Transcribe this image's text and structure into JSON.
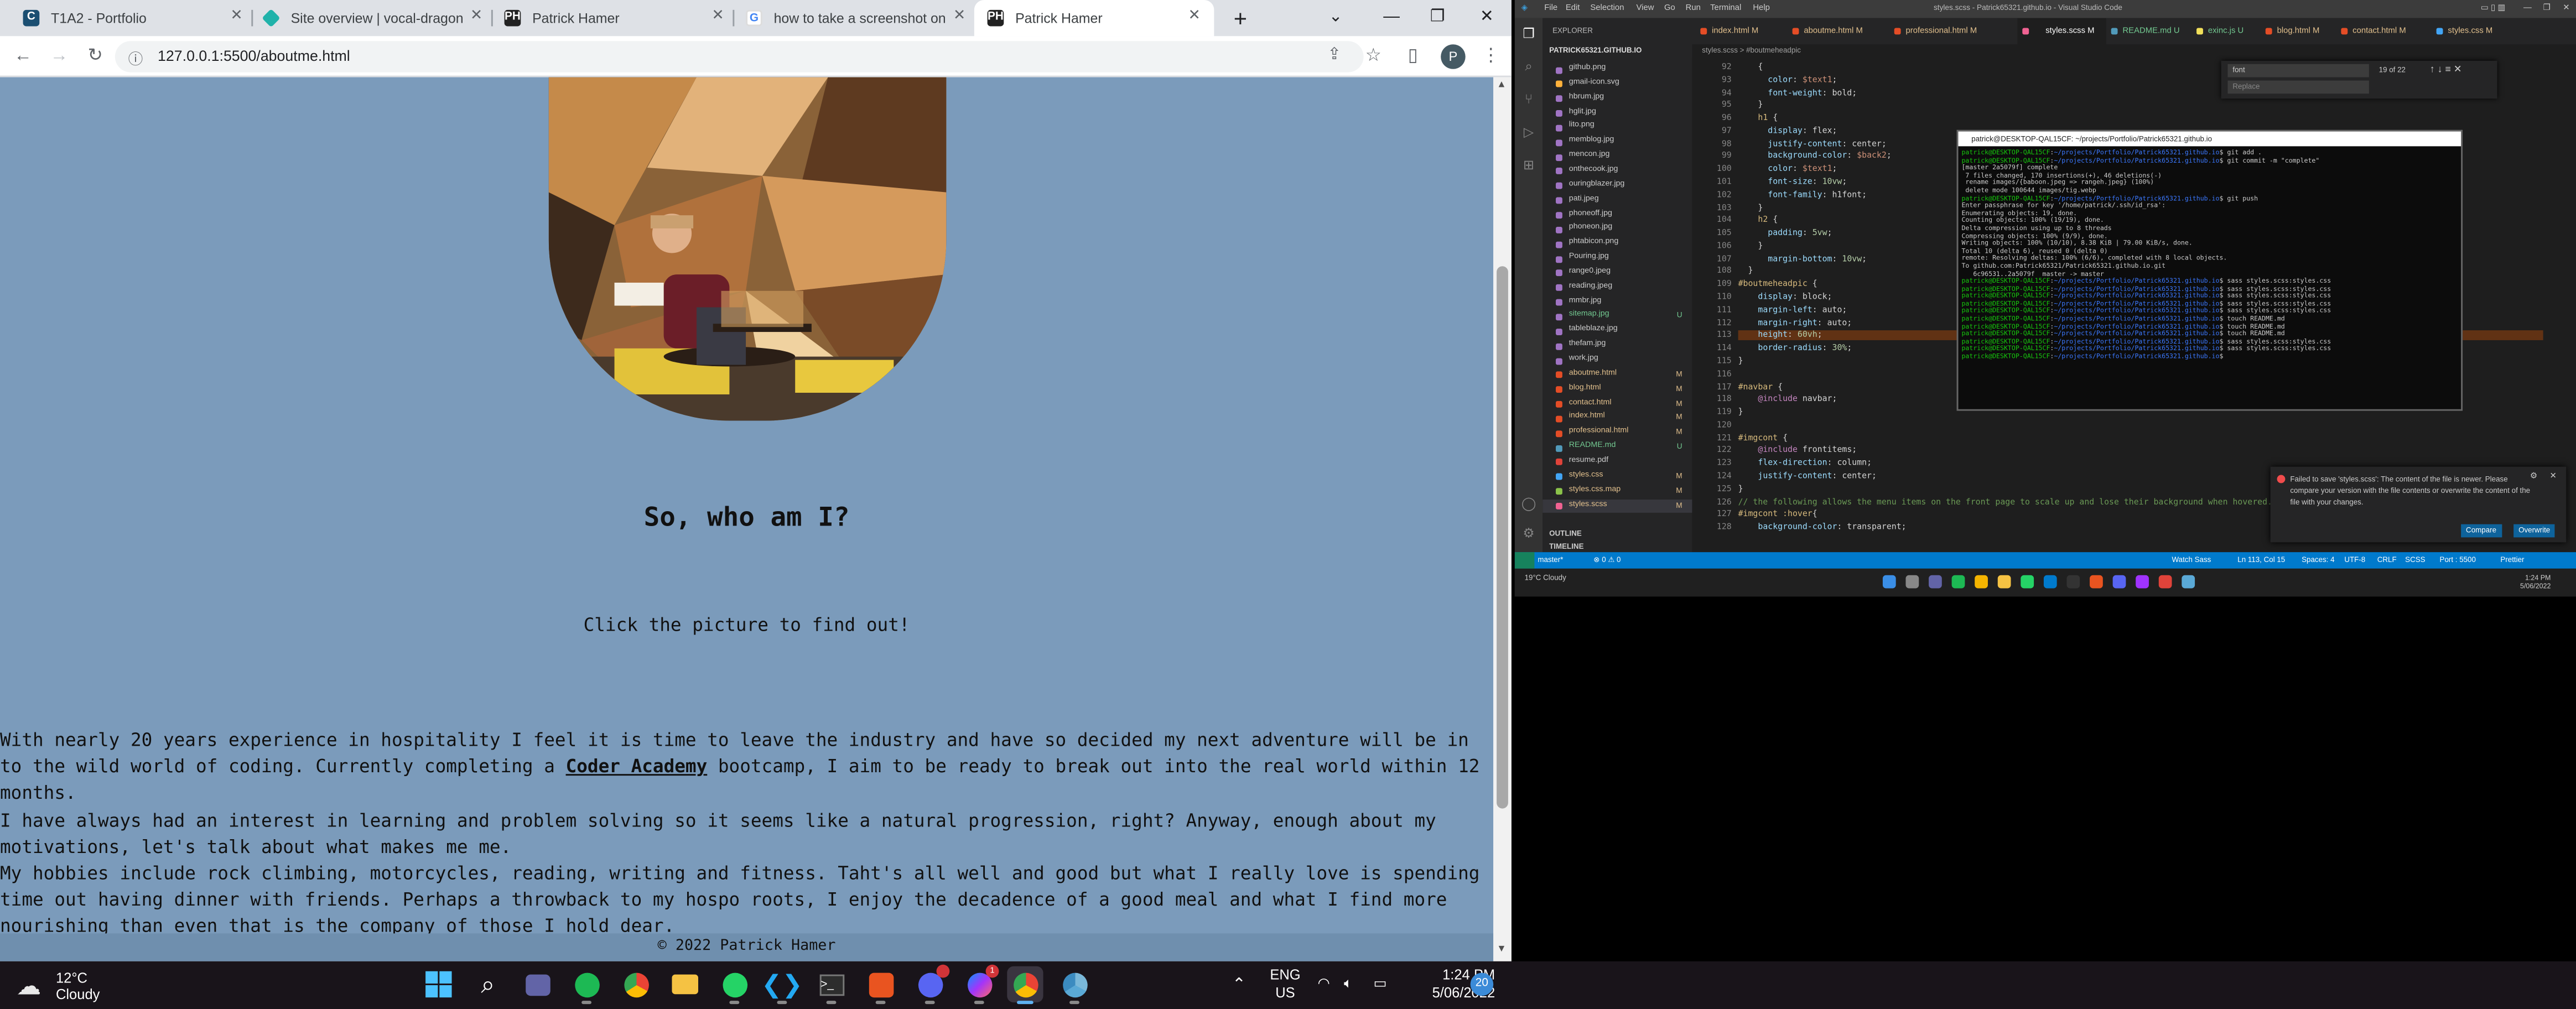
{
  "browser": {
    "tabs": [
      {
        "title": "T1A2 - Portfolio",
        "icon": "canvas-icon",
        "color": "#1b4f72",
        "active": false
      },
      {
        "title": "Site overview | vocal-dragon",
        "icon": "netlify-icon",
        "color": "#20b2aa",
        "active": false
      },
      {
        "title": "Patrick Hamer",
        "icon": "ph-icon",
        "color": "#222222",
        "active": false
      },
      {
        "title": "how to take a screenshot on",
        "icon": "google-icon",
        "color": "#4285f4",
        "active": false
      },
      {
        "title": "Patrick Hamer",
        "icon": "ph-icon",
        "color": "#222222",
        "active": true
      }
    ],
    "new_tab": "+",
    "url": "127.0.0.1:5500/aboutme.html",
    "profile_initial": "P"
  },
  "page": {
    "heading": "So, who am I?",
    "subheading": "Click the picture to find out!",
    "bio_p1_before": "With nearly 20 years experience in hospitality I feel it is time to leave the industry and have so decided my next adventure will be in to the wild world of coding. Currently completing a ",
    "bio_link": "Coder Academy",
    "bio_p1_after": " bootcamp, I aim to be ready to break out into the real world within 12 months.",
    "bio_p2": "I have always had an interest in learning and problem solving so it seems like a natural progression, right? Anyway, enough about my motivations, let's talk about what makes me me.",
    "bio_p3": "My hobbies include rock climbing, motorcycles, reading, writing and fitness. Taht's all well and good but what I really love is spending time out having dinner with friends. Perhaps a throwback to my hospo roots, I enjoy the decadence of a good meal and what I find more nourishing than even that is the company of those I hold dear.",
    "footer": "© 2022 Patrick Hamer",
    "background_color": "#7b9bbb"
  },
  "vscode": {
    "title": "styles.scss - Patrick65321.github.io - Visual Studio Code",
    "menu": [
      "File",
      "Edit",
      "Selection",
      "View",
      "Go",
      "Run",
      "Terminal",
      "Help"
    ],
    "explorer_label": "EXPLORER",
    "project": "PATRICK65321.GITHUB.IO",
    "files": [
      {
        "name": "github.png",
        "badge": ""
      },
      {
        "name": "gmail-icon.svg",
        "badge": ""
      },
      {
        "name": "hbrum.jpg",
        "badge": ""
      },
      {
        "name": "hglit.jpg",
        "badge": ""
      },
      {
        "name": "lito.png",
        "badge": ""
      },
      {
        "name": "memblog.jpg",
        "badge": ""
      },
      {
        "name": "mencon.jpg",
        "badge": ""
      },
      {
        "name": "onthecook.jpg",
        "badge": ""
      },
      {
        "name": "ouringblazer.jpg",
        "badge": ""
      },
      {
        "name": "pati.jpeg",
        "badge": ""
      },
      {
        "name": "phoneoff.jpg",
        "badge": ""
      },
      {
        "name": "phoneon.jpg",
        "badge": ""
      },
      {
        "name": "phtabicon.png",
        "badge": ""
      },
      {
        "name": "Pouring.jpg",
        "badge": ""
      },
      {
        "name": "range0.jpeg",
        "badge": ""
      },
      {
        "name": "reading.jpeg",
        "badge": ""
      },
      {
        "name": "mmbr.jpg",
        "badge": ""
      },
      {
        "name": "sitemap.jpg",
        "badge": "U"
      },
      {
        "name": "tableblaze.jpg",
        "badge": ""
      },
      {
        "name": "thefam.jpg",
        "badge": ""
      },
      {
        "name": "work.jpg",
        "badge": ""
      },
      {
        "name": "aboutme.html",
        "badge": "M"
      },
      {
        "name": "blog.html",
        "badge": "M"
      },
      {
        "name": "contact.html",
        "badge": "M"
      },
      {
        "name": "index.html",
        "badge": "M"
      },
      {
        "name": "professional.html",
        "badge": "M"
      },
      {
        "name": "README.md",
        "badge": "U"
      },
      {
        "name": "resume.pdf",
        "badge": ""
      },
      {
        "name": "styles.css",
        "badge": "M"
      },
      {
        "name": "styles.css.map",
        "badge": "M"
      },
      {
        "name": "styles.scss",
        "badge": "M"
      }
    ],
    "outline_label": "OUTLINE",
    "timeline_label": "TIMELINE",
    "tabs": [
      "index.html M",
      "aboutme.html M",
      "professional.html M",
      "styles.scss M",
      "README.md U",
      "exinc.js U",
      "blog.html M",
      "contact.html M",
      "styles.css M"
    ],
    "breadcrumb": "styles.scss > #boutmeheadpic",
    "find_value": "font",
    "find_count": "19 of 22",
    "replace_placeholder": "Replace",
    "line_numbers": [
      "92",
      "93",
      "94",
      "95",
      "96",
      "97",
      "98",
      "99",
      "100",
      "101",
      "102",
      "103",
      "104",
      "105",
      "106",
      "107",
      "108",
      "109",
      "110",
      "111",
      "112",
      "113",
      "114",
      "115",
      "116",
      "117",
      "118",
      "119",
      "120",
      "121",
      "122",
      "123",
      "124",
      "125",
      "126",
      "127",
      "128"
    ],
    "code_lines": [
      "    {",
      "      color: $text1;",
      "      font-weight: bold;",
      "    }",
      "    h1 {",
      "      display: flex;",
      "      justify-content: center;",
      "      background-color: $back2;",
      "      color: $text1;",
      "      font-size: 10vw;",
      "      font-family: h1font;",
      "    }",
      "    h2 {",
      "      padding: 5vw;",
      "    }",
      "      margin-bottom: 10vw;",
      "  }",
      "#boutmeheadpic {",
      "    display: block;",
      "    margin-left: auto;",
      "    margin-right: auto;",
      "    height: 60vh;",
      "    border-radius: 30%;",
      "}",
      "",
      "#navbar {",
      "    @include navbar;",
      "}",
      "",
      "#imgcont {",
      "    @include frontitems;",
      "    flex-direction: column;",
      "    justify-content: center;",
      "}",
      "// the following allows the menu items on the front page to scale up and lose their background when hovered.",
      "#imgcont :hover{",
      "    background-color: transparent;"
    ],
    "terminal_title": "patrick@DESKTOP-QAL15CF: ~/projects/Portfolio/Patrick65321.github.io",
    "terminal_lines": [
      "patrick@DESKTOP-QAL15CF:~/projects/Portfolio/Patrick65321.github.io$ git add .",
      "patrick@DESKTOP-QAL15CF:~/projects/Portfolio/Patrick65321.github.io$ git commit -m \"complete\"",
      "[master 2a5079f] complete",
      " 7 files changed, 170 insertions(+), 46 deletions(-)",
      " rename images/{baboon.jpeg => rangeh.jpeg} (100%)",
      " delete mode 100644 images/tig.webp",
      "patrick@DESKTOP-QAL15CF:~/projects/Portfolio/Patrick65321.github.io$ git push",
      "Enter passphrase for key '/home/patrick/.ssh/id_rsa':",
      "Enumerating objects: 19, done.",
      "Counting objects: 100% (19/19), done.",
      "Delta compression using up to 8 threads",
      "Compressing objects: 100% (9/9), done.",
      "Writing objects: 100% (10/10), 8.38 KiB | 79.00 KiB/s, done.",
      "Total 10 (delta 6), reused 0 (delta 0)",
      "remote: Resolving deltas: 100% (6/6), completed with 8 local objects.",
      "To github.com:Patrick65321/Patrick65321.github.io.git",
      "   6c96531..2a5079f  master -> master",
      "patrick@DESKTOP-QAL15CF:~/projects/Portfolio/Patrick65321.github.io$ sass styles.scss:styles.css",
      "patrick@DESKTOP-QAL15CF:~/projects/Portfolio/Patrick65321.github.io$ sass styles.scss:styles.css",
      "patrick@DESKTOP-QAL15CF:~/projects/Portfolio/Patrick65321.github.io$ sass styles.scss:styles.css",
      "patrick@DESKTOP-QAL15CF:~/projects/Portfolio/Patrick65321.github.io$ sass styles.scss:styles.css",
      "patrick@DESKTOP-QAL15CF:~/projects/Portfolio/Patrick65321.github.io$ sass styles.scss:styles.css",
      "patrick@DESKTOP-QAL15CF:~/projects/Portfolio/Patrick65321.github.io$ touch README.md",
      "patrick@DESKTOP-QAL15CF:~/projects/Portfolio/Patrick65321.github.io$ touch README.md",
      "patrick@DESKTOP-QAL15CF:~/projects/Portfolio/Patrick65321.github.io$ touch README.md",
      "patrick@DESKTOP-QAL15CF:~/projects/Portfolio/Patrick65321.github.io$ sass styles.scss:styles.css",
      "patrick@DESKTOP-QAL15CF:~/projects/Portfolio/Patrick65321.github.io$ sass styles.scss:styles.css",
      "patrick@DESKTOP-QAL15CF:~/projects/Portfolio/Patrick65321.github.io$ "
    ],
    "toast_message": "Failed to save 'styles.scss': The content of the file is newer. Please compare your version with the file contents or overwrite the content of the file with your changes.",
    "toast_compare": "Compare",
    "toast_overwrite": "Overwrite",
    "status_left": "master*",
    "status_errors": "⊗ 0 ⚠ 0",
    "status_watch": "Watch Sass",
    "status_pos": "Ln 113, Col 15",
    "status_spaces": "Spaces: 4",
    "status_enc": "UTF-8",
    "status_eol": "CRLF",
    "status_lang": "SCSS",
    "status_port": "Port : 5500",
    "status_prettier": "Prettier",
    "mini_weather": "19°C Cloudy",
    "mini_time": "1:24 PM",
    "mini_date": "5/06/2022"
  },
  "taskbar": {
    "weather_temp": "12°C",
    "weather_desc": "Cloudy",
    "apps": [
      "windows-start-icon",
      "search-icon",
      "teams-icon",
      "spotify-icon",
      "chrome-icon",
      "file-explorer-icon",
      "whatsapp-icon",
      "vscode-icon",
      "terminal-icon",
      "ubuntu-icon",
      "discord-icon",
      "messenger-icon",
      "chrome-profile-icon",
      "chrome-alt-icon"
    ],
    "discord_badge": "",
    "messenger_badge": "1",
    "lang": "ENG",
    "region": "US",
    "time": "1:24 PM",
    "date": "5/06/2022",
    "notifications": "20"
  }
}
